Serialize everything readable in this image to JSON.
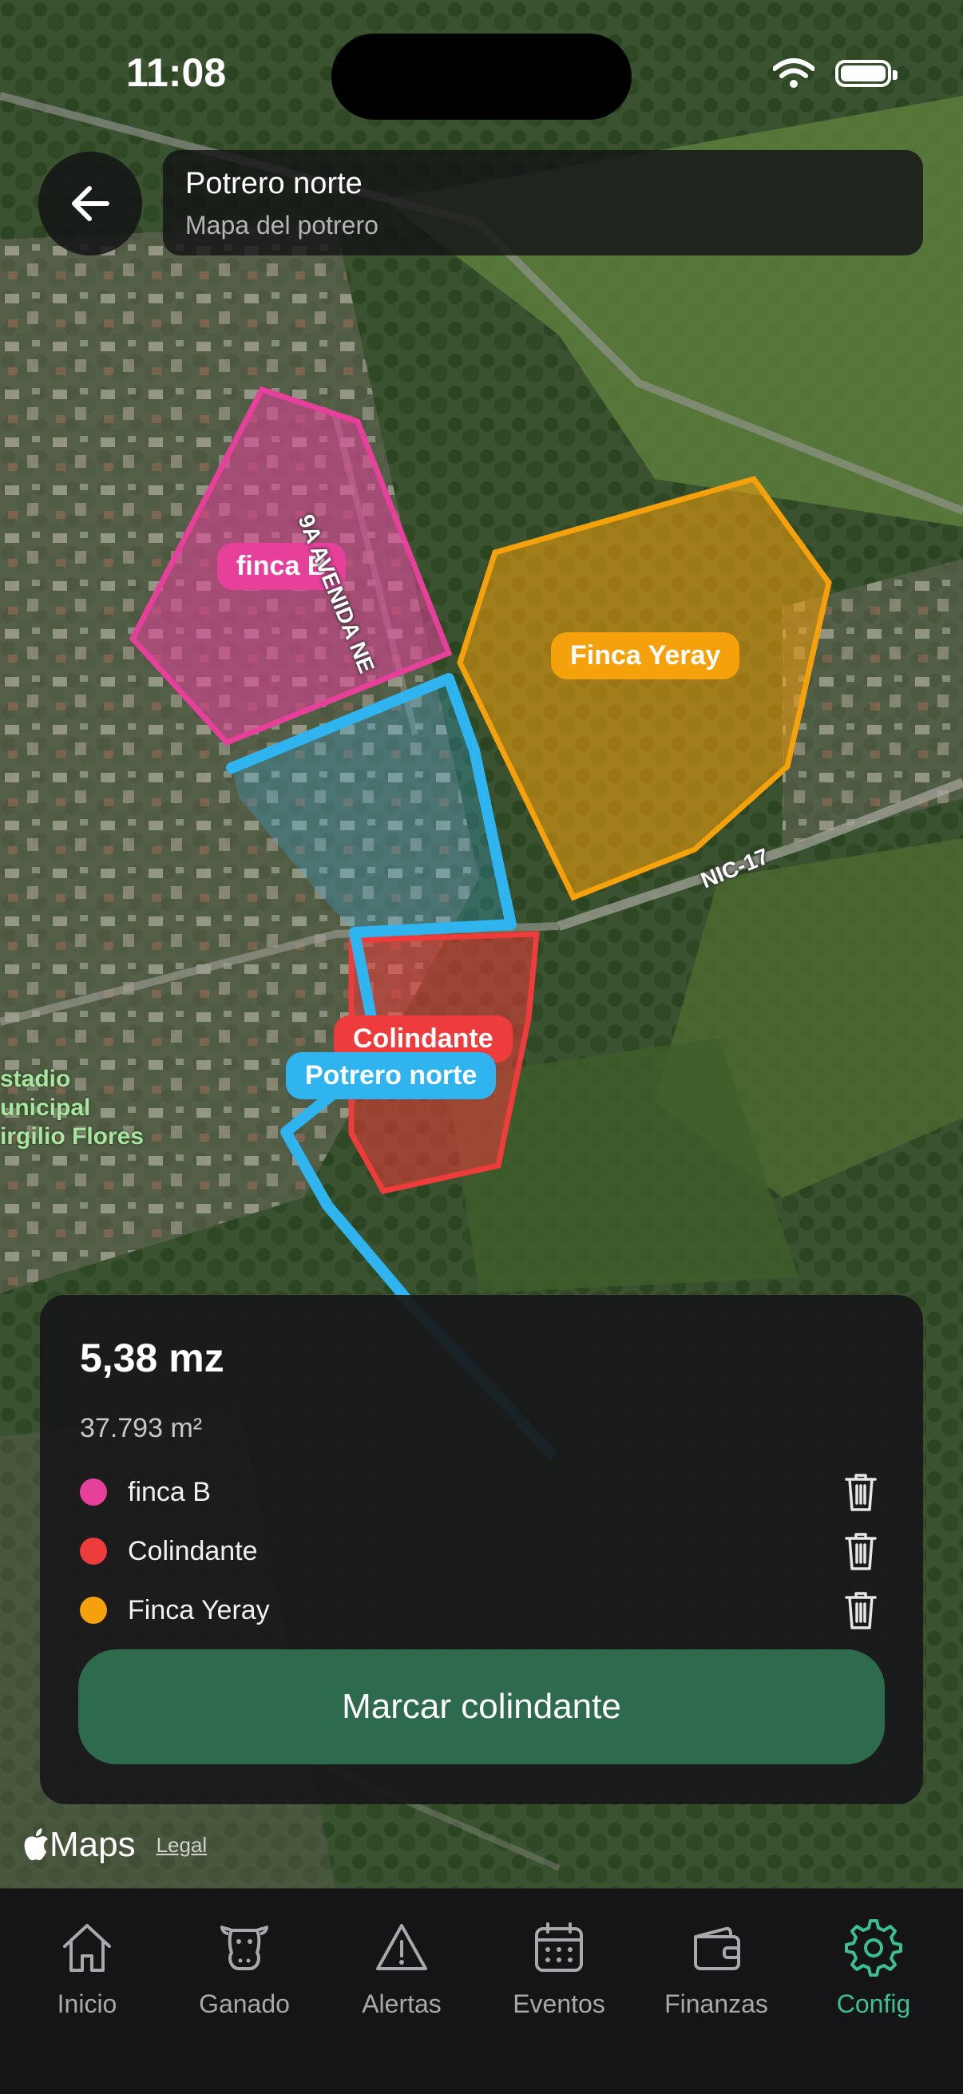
{
  "status_bar": {
    "time": "11:08"
  },
  "header": {
    "title": "Potrero norte",
    "subtitle": "Mapa del potrero"
  },
  "map": {
    "polygon_labels": {
      "finca_b": "finca B",
      "finca_yeray": "Finca Yeray",
      "colindante": "Colindante",
      "potrero_norte": "Potrero norte"
    },
    "street_labels": {
      "avenida": "9A AVENIDA NE",
      "nic": "NIC-17"
    },
    "poi_label": "stadio\nunicipal\nirgilio Flores",
    "attribution": {
      "brand": "Maps",
      "legal": "Legal"
    },
    "colors": {
      "finca_b": "#e7409a",
      "finca_yeray": "#f5a10c",
      "colindante": "#ee3b3b",
      "potrero_norte": "#2fb4ef"
    }
  },
  "panel": {
    "area_mz": "5,38 mz",
    "area_m2": "37.793 m²",
    "items": [
      {
        "label": "finca B",
        "color": "#e7409a"
      },
      {
        "label": "Colindante",
        "color": "#ee3b3b"
      },
      {
        "label": "Finca Yeray",
        "color": "#f5a10c"
      }
    ],
    "action_label": "Marcar colindante"
  },
  "tabs": [
    {
      "label": "Inicio",
      "icon": "house-icon"
    },
    {
      "label": "Ganado",
      "icon": "cow-icon"
    },
    {
      "label": "Alertas",
      "icon": "warning-icon"
    },
    {
      "label": "Eventos",
      "icon": "calendar-icon"
    },
    {
      "label": "Finanzas",
      "icon": "wallet-icon"
    },
    {
      "label": "Config",
      "icon": "gear-icon",
      "active": true
    }
  ]
}
